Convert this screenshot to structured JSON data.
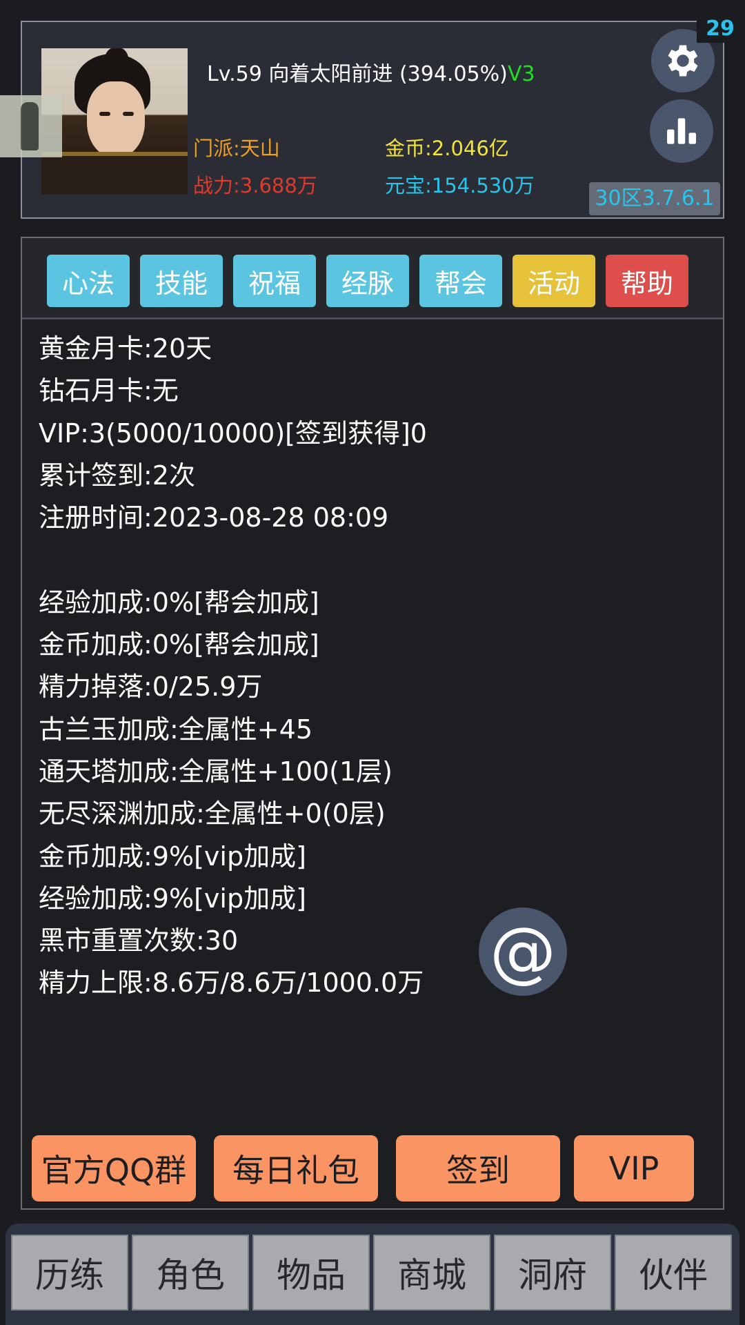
{
  "profile": {
    "level": "Lv.59",
    "name": "向着太阳前进",
    "exp_percent": "(394.05%)",
    "vip_label": "V3",
    "sect": "门派:天山",
    "gold": "金币:2.046亿",
    "power": "战力:3.688万",
    "ingot": "元宝:154.530万",
    "server": "30区3.7.6.1",
    "notification_count": "29"
  },
  "tabs": [
    {
      "label": "心法",
      "color": "#5bc5e1"
    },
    {
      "label": "技能",
      "color": "#5bc5e1"
    },
    {
      "label": "祝福",
      "color": "#5bc5e1"
    },
    {
      "label": "经脉",
      "color": "#5bc5e1"
    },
    {
      "label": "帮会",
      "color": "#5bc5e1"
    },
    {
      "label": "活动",
      "color": "#e6c23a"
    },
    {
      "label": "帮助",
      "color": "#de4e4a"
    }
  ],
  "info_lines": [
    "黄金月卡:20天",
    "钻石月卡:无",
    "VIP:3(5000/10000)[签到获得]0",
    "累计签到:2次",
    "注册时间:2023-08-28 08:09",
    "",
    "经验加成:0%[帮会加成]",
    "金币加成:0%[帮会加成]",
    "精力掉落:0/25.9万",
    "古兰玉加成:全属性+45",
    "通天塔加成:全属性+100(1层)",
    "无尽深渊加成:全属性+0(0层)",
    "金币加成:9%[vip加成]",
    "经验加成:9%[vip加成]",
    "黑市重置次数:30",
    "精力上限:8.6万/8.6万/1000.0万"
  ],
  "at_button": "@",
  "actions": [
    "官方QQ群",
    "每日礼包",
    "签到",
    "VIP"
  ],
  "bottom_nav": [
    "历练",
    "角色",
    "物品",
    "商城",
    "洞府",
    "伙伴"
  ],
  "icons": {
    "settings": "gear-icon",
    "stats": "bar-chart-icon"
  }
}
